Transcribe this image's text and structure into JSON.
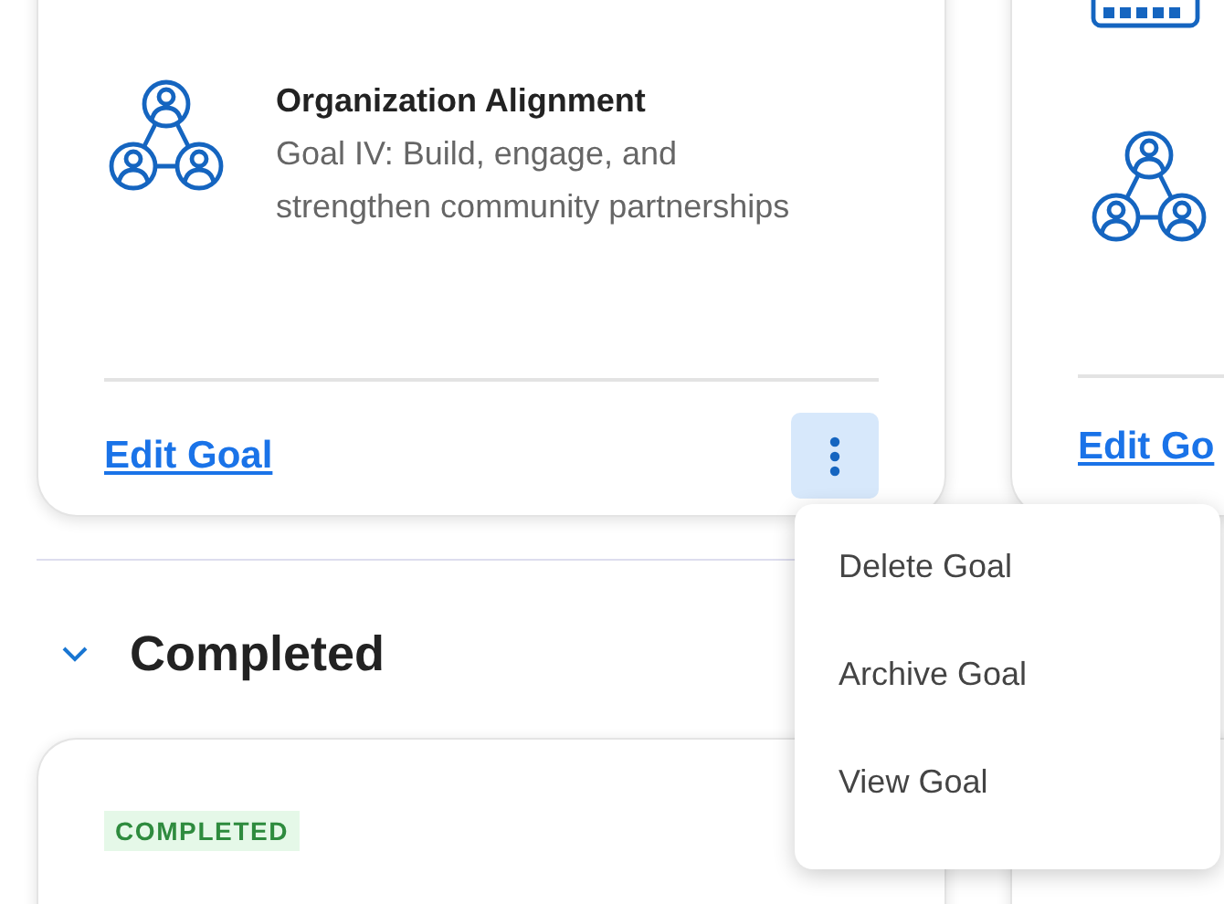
{
  "goal_cards": [
    {
      "kind": "full",
      "title": "Organization Alignment",
      "description": "Goal IV: Build, engage, and strengthen community partnerships",
      "edit_link": "Edit Goal",
      "menu_open": true
    },
    {
      "kind": "partial",
      "edit_link": "Edit Go"
    }
  ],
  "context_menu": {
    "items": [
      "Delete Goal",
      "Archive Goal",
      "View Goal"
    ]
  },
  "section": {
    "title": "Completed",
    "expanded": true
  },
  "completed_cards": [
    {
      "status": "COMPLETED"
    }
  ]
}
